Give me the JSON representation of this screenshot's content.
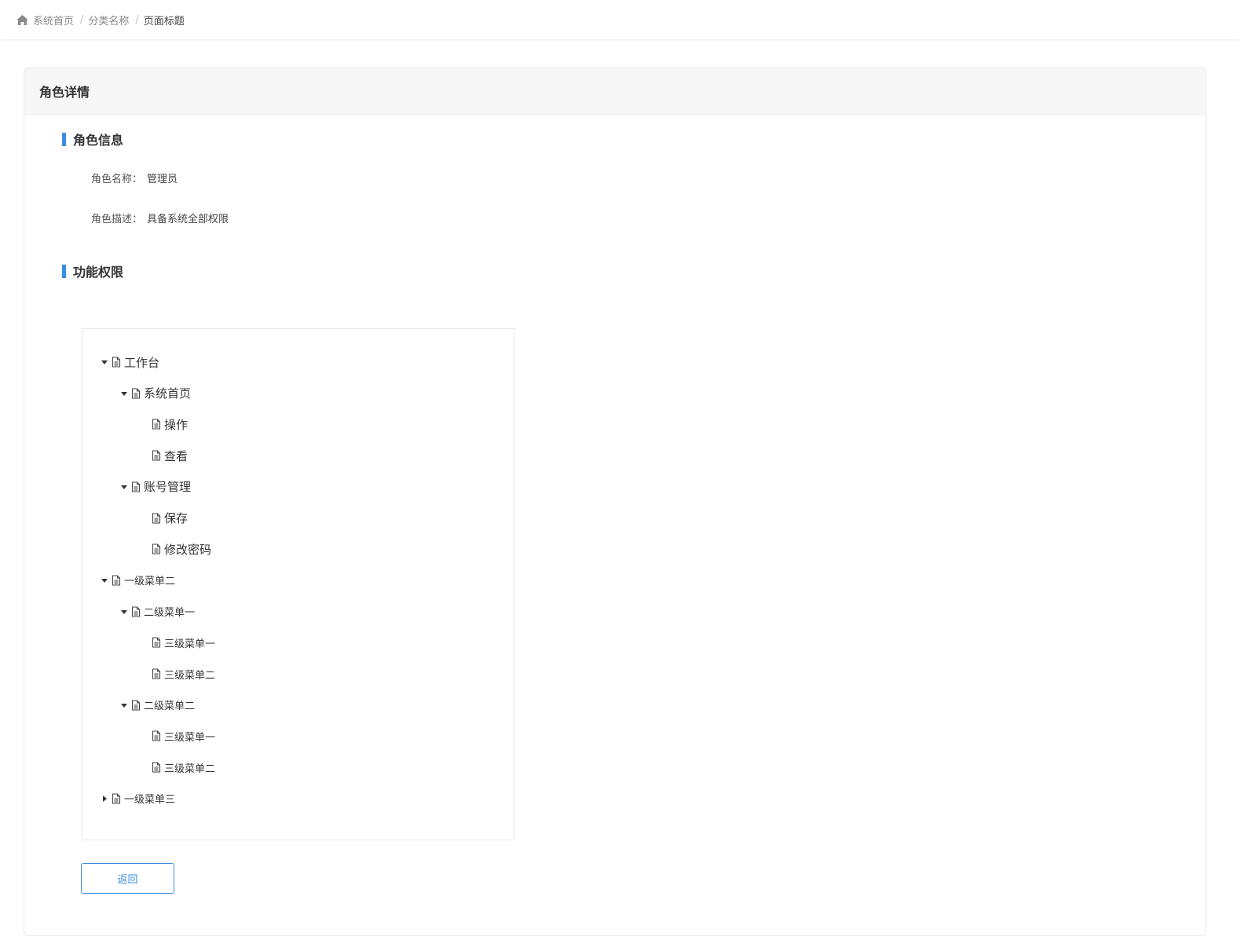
{
  "breadcrumb": {
    "items": [
      "系统首页",
      "分类名称",
      "页面标题"
    ],
    "separator": "/"
  },
  "panel": {
    "title": "角色详情"
  },
  "role_info": {
    "section_title": "角色信息",
    "name_label": "角色名称：",
    "name_value": "管理员",
    "desc_label": "角色描述：",
    "desc_value": "具备系统全部权限"
  },
  "permissions": {
    "section_title": "功能权限",
    "tree": [
      {
        "label": "工作台",
        "level": 0,
        "caret": "down",
        "size": "large"
      },
      {
        "label": "系统首页",
        "level": 1,
        "caret": "down",
        "size": "large"
      },
      {
        "label": "操作",
        "level": 2,
        "caret": "none",
        "size": "large"
      },
      {
        "label": "查看",
        "level": 2,
        "caret": "none",
        "size": "large"
      },
      {
        "label": "账号管理",
        "level": 1,
        "caret": "down",
        "size": "large"
      },
      {
        "label": "保存",
        "level": 2,
        "caret": "none",
        "size": "large"
      },
      {
        "label": "修改密码",
        "level": 2,
        "caret": "none",
        "size": "large"
      },
      {
        "label": "一级菜单二",
        "level": 0,
        "caret": "down",
        "size": "small"
      },
      {
        "label": "二级菜单一",
        "level": 1,
        "caret": "down",
        "size": "small"
      },
      {
        "label": "三级菜单一",
        "level": 2,
        "caret": "none",
        "size": "small"
      },
      {
        "label": "三级菜单二",
        "level": 2,
        "caret": "none",
        "size": "small"
      },
      {
        "label": "二级菜单二",
        "level": 1,
        "caret": "down",
        "size": "small"
      },
      {
        "label": "三级菜单一",
        "level": 2,
        "caret": "none",
        "size": "small"
      },
      {
        "label": "三级菜单二",
        "level": 2,
        "caret": "none",
        "size": "small"
      },
      {
        "label": "一级菜单三",
        "level": 0,
        "caret": "right",
        "size": "small"
      }
    ]
  },
  "actions": {
    "back_label": "返回"
  },
  "colors": {
    "accent": "#3a8ee6",
    "header_bg": "#f7f7f7"
  }
}
